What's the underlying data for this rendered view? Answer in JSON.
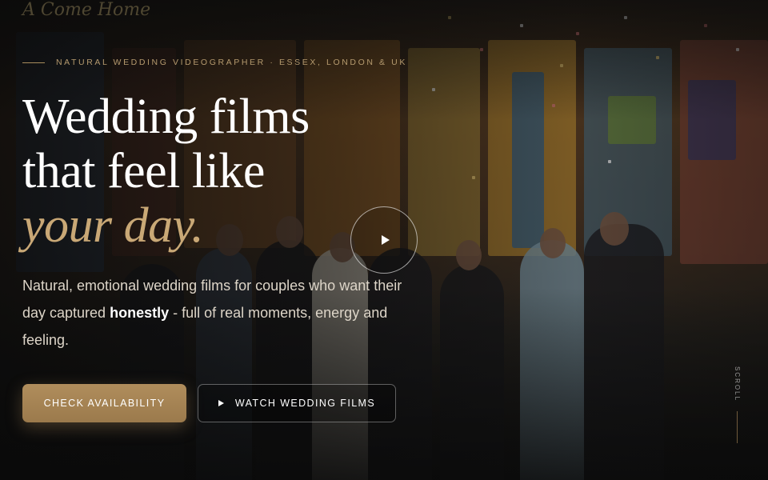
{
  "background": {
    "faded_sign_text": "A Come Home"
  },
  "hero": {
    "eyebrow": "NATURAL WEDDING VIDEOGRAPHER · ESSEX, LONDON & UK",
    "headline_line1": "Wedding films",
    "headline_line2": "that feel like",
    "headline_line3": "your day.",
    "subtitle_part1": "Natural, emotional wedding films for couples who want their day captured ",
    "subtitle_bold": "honestly",
    "subtitle_part2": " - full of real moments, energy and feeling."
  },
  "buttons": {
    "primary_label": "CHECK AVAILABILITY",
    "secondary_label": "WATCH WEDDING FILMS"
  },
  "play_button": {
    "icon": "play-icon"
  },
  "scroll": {
    "label": "SCROLL"
  },
  "colors": {
    "accent": "#b08d5c",
    "accent_text": "#c9a876",
    "background": "#111111"
  }
}
